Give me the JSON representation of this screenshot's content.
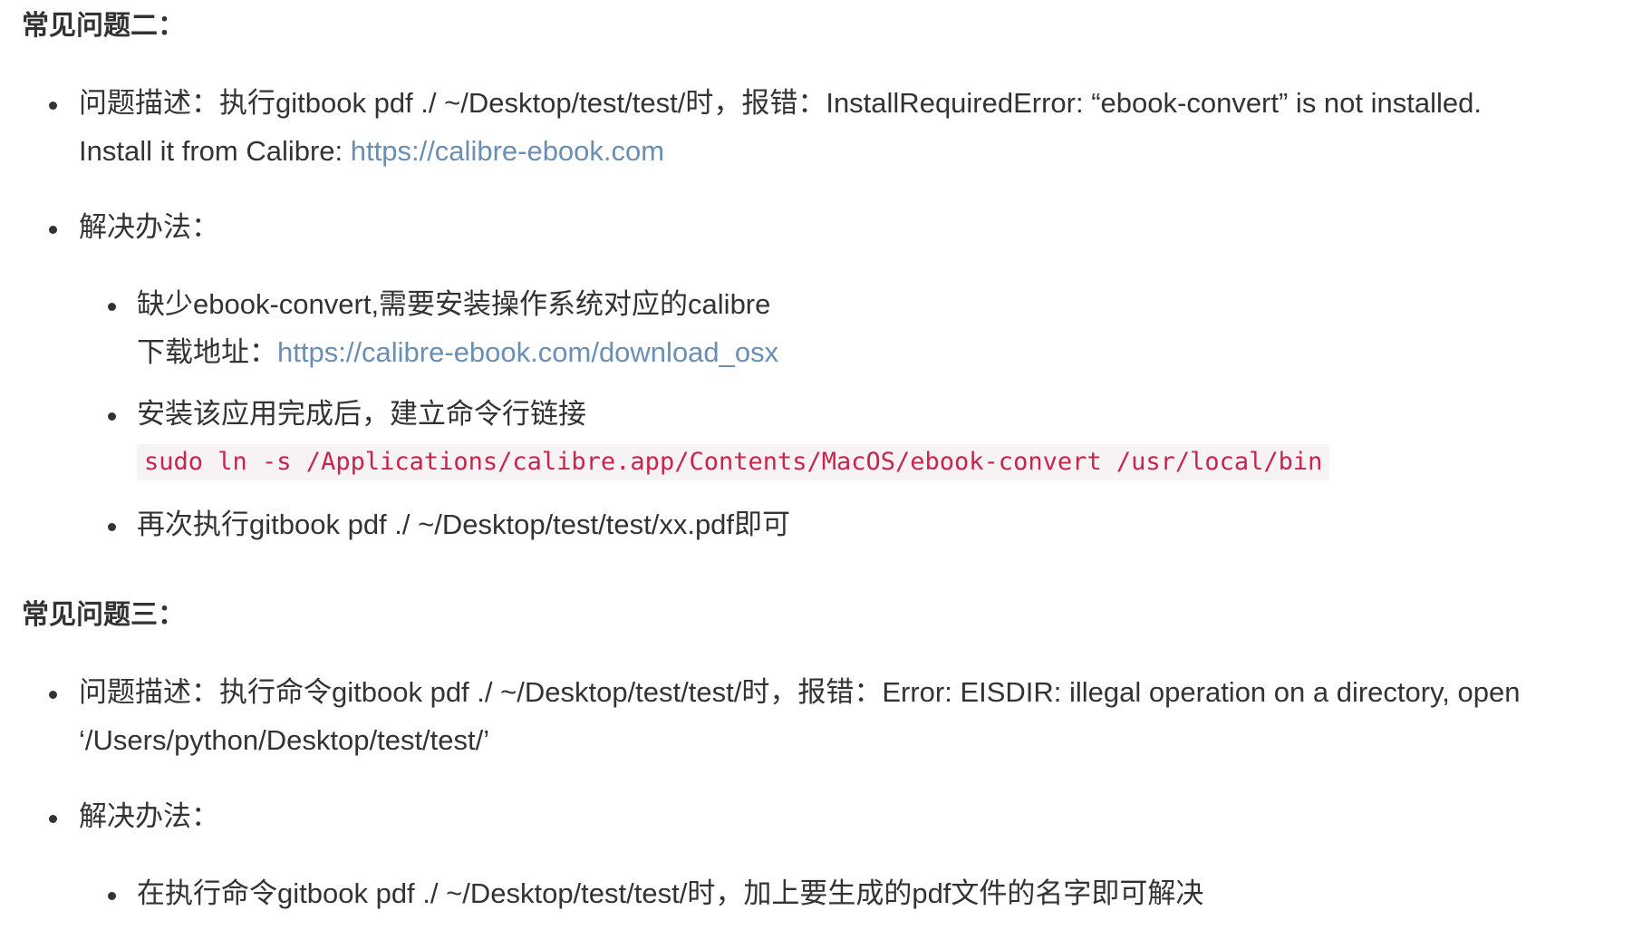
{
  "section2": {
    "heading": "常见问题二：",
    "desc_line1": "问题描述：执行gitbook pdf ./ ~/Desktop/test/test/时，报错：InstallRequiredError: “ebook-convert” is not installed.",
    "desc_line2_prefix": "Install it from Calibre: ",
    "desc_link": "https://calibre-ebook.com",
    "solution_label": "解决办法：",
    "sub1_line1": "缺少ebook-convert,需要安装操作系统对应的calibre",
    "sub1_line2_prefix": "下载地址：",
    "sub1_link": "https://calibre-ebook.com/download_osx",
    "sub2_line1": "安装该应用完成后，建立命令行链接",
    "sub2_code": "sudo ln -s /Applications/calibre.app/Contents/MacOS/ebook-convert /usr/local/bin",
    "sub3_line1": "再次执行gitbook pdf ./ ~/Desktop/test/test/xx.pdf即可"
  },
  "section3": {
    "heading": "常见问题三：",
    "desc_line1": "问题描述：执行命令gitbook pdf ./ ~/Desktop/test/test/时，报错：Error: EISDIR: illegal operation on a directory, open",
    "desc_line2": "‘/Users/python/Desktop/test/test/’",
    "solution_label": "解决办法：",
    "sub1_line1": "在执行命令gitbook pdf ./ ~/Desktop/test/test/时，加上要生成的pdf文件的名字即可解决"
  },
  "colors": {
    "text": "#333333",
    "link": "#6a8fb3",
    "code_text": "#c7254e",
    "code_bg": "#f7f2f4"
  }
}
